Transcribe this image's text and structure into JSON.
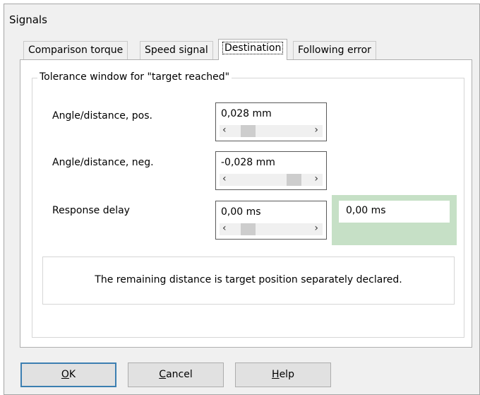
{
  "window": {
    "title": "Signals"
  },
  "tabs": [
    {
      "label": "Comparison torque",
      "active": false
    },
    {
      "label": "Speed signal",
      "active": false
    },
    {
      "label": "Destination",
      "active": true
    },
    {
      "label": "Following error",
      "active": false
    }
  ],
  "group": {
    "title": "Tolerance window for \"target reached\""
  },
  "fields": {
    "pos": {
      "label": "Angle/distance, pos.",
      "value": "0,028 mm",
      "slider_fraction": 0.13
    },
    "neg": {
      "label": "Angle/distance, neg.",
      "value": "-0,028 mm",
      "slider_fraction": 0.87
    },
    "delay": {
      "label": "Response delay",
      "value": "0,00 ms",
      "slider_fraction": 0.13
    }
  },
  "scroll_icons": {
    "left": "‹",
    "right": "›"
  },
  "result": {
    "value": "0,00 ms",
    "color": "#c6e0c6"
  },
  "info": {
    "text": "The remaining distance is target position separately declared."
  },
  "buttons": {
    "ok": {
      "mnemonic": "O",
      "rest": "K"
    },
    "cancel": {
      "mnemonic": "C",
      "rest": "ancel"
    },
    "help": {
      "mnemonic": "H",
      "rest": "elp"
    }
  }
}
